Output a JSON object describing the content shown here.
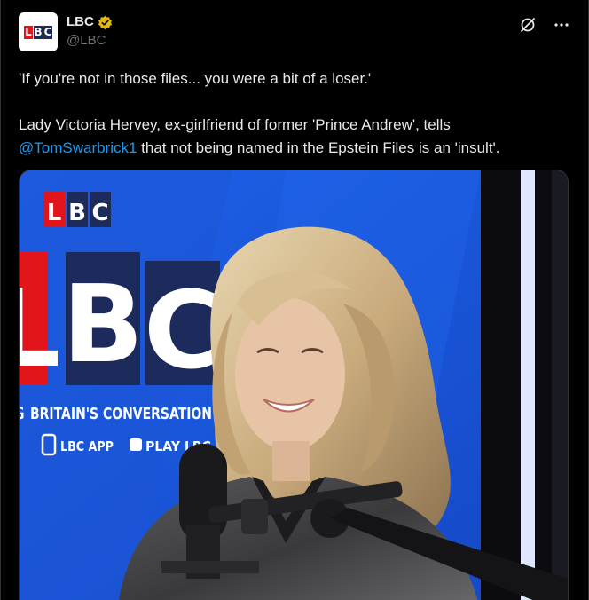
{
  "account": {
    "display_name": "LBC",
    "handle": "@LBC",
    "verified": true,
    "avatar_letters": [
      "L",
      "B",
      "C"
    ]
  },
  "header": {
    "grok_icon": "grok-slash-icon",
    "more_icon": "more-dots-icon"
  },
  "tweet": {
    "line1": "'If you're not in those files... you were a bit of a loser.'",
    "line2_prefix": "Lady Victoria Hervey, ex-girlfriend of former 'Prince Andrew', tells",
    "mention": "@TomSwarbrick1",
    "line2_suffix": " that not being named in the Epstein Files is an 'insult'."
  },
  "media": {
    "backdrop_logo_small": [
      "L",
      "B",
      "C"
    ],
    "backdrop_logo_large": [
      "L",
      "B",
      "C"
    ],
    "tagline": "BRITAIN'S CONVERSATION",
    "tagline_prefix": "G",
    "app_label": "LBC APP",
    "play_label": "PLAY LBC",
    "colors": {
      "backdrop_blue": "#1a5be0",
      "lbc_red": "#e3151c",
      "lbc_navy": "#1c2a5c"
    }
  },
  "colors": {
    "background": "#000000",
    "text": "#e7e9ea",
    "muted": "#71767b",
    "link": "#1d9bf0",
    "verified_gold": "#e2b719"
  }
}
